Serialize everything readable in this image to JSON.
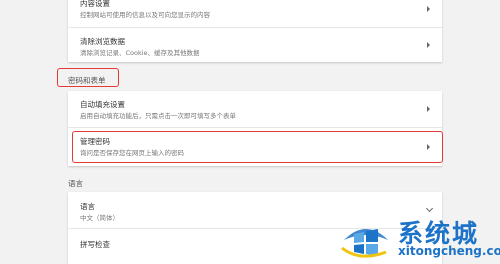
{
  "privacy_card": {
    "content_settings": {
      "title": "内容设置",
      "desc": "控制网站可使用的信息以及可向您显示的内容"
    },
    "clear_browsing": {
      "title": "清除浏览数据",
      "desc": "清除浏览记录、Cookie、缓存及其他数据"
    }
  },
  "passwords_section": {
    "label": "密码和表单",
    "autofill": {
      "title": "自动填充设置",
      "desc": "启用自动填充功能后，只需点击一次即可填写多个表单"
    },
    "manage_passwords": {
      "title": "管理密码",
      "desc": "询问是否保存您在网页上输入的密码"
    }
  },
  "languages_section": {
    "label": "语言",
    "language": {
      "title": "语言",
      "desc": "中文（简体）"
    },
    "spellcheck": {
      "title": "拼写检查"
    }
  },
  "watermark": {
    "text_cn": "系统城",
    "text_en": "xitongcheng.com"
  },
  "colors": {
    "highlight_red": "#e53935",
    "watermark_blue": "#1d73c8"
  }
}
